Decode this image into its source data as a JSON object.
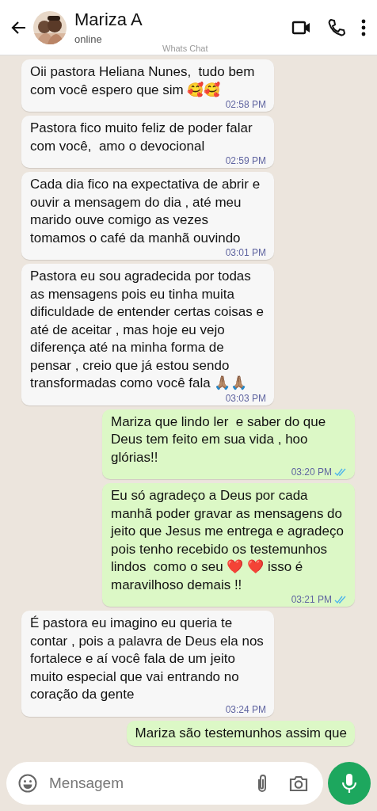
{
  "header": {
    "name": "Mariza A",
    "status": "online",
    "watermark": "Whats Chat"
  },
  "messages": [
    {
      "kind": "incoming",
      "text": "Oii pastora Heliana Nunes,  tudo bem com você espero que sim 🥰🥰",
      "time": "02:58 PM"
    },
    {
      "kind": "incoming",
      "text": "Pastora fico muito feliz de poder falar com você,  amo o devocional",
      "time": "02:59 PM"
    },
    {
      "kind": "incoming",
      "text": "Cada dia fico na expectativa de abrir e ouvir a mensagem do dia , até meu marido ouve comigo as vezes tomamos o café da manhã ouvindo",
      "time": "03:01 PM"
    },
    {
      "kind": "incoming",
      "text": "Pastora eu sou agradecida por todas as mensagens pois eu tinha muita dificuldade de entender certas coisas e até de aceitar , mas hoje eu vejo diferença até na minha forma de pensar , creio que já estou sendo transformadas como você fala 🙏🏽🙏🏽",
      "time": "03:03 PM"
    },
    {
      "kind": "outgoing",
      "text": "Mariza que lindo ler  e saber do que Deus tem feito em sua vida , hoo glórias!!",
      "time": "03:20 PM",
      "read": true
    },
    {
      "kind": "outgoing",
      "text": "Eu só agradeço a Deus por cada manhã poder gravar as mensagens do jeito que Jesus me entrega e agradeço pois tenho recebido os testemunhos lindos  como o seu ❤️ ❤️ isso é maravilhoso demais !!",
      "time": "03:21 PM",
      "read": true
    },
    {
      "kind": "incoming",
      "text": "É pastora eu imagino eu queria te contar , pois a palavra de Deus ela nos fortalece e aí você fala de um jeito muito especial que vai entrando no coração da gente",
      "time": "03:24 PM"
    },
    {
      "kind": "outgoing",
      "text": "Mariza são testemunhos assim que"
    }
  ],
  "composer": {
    "placeholder": "Mensagem"
  }
}
